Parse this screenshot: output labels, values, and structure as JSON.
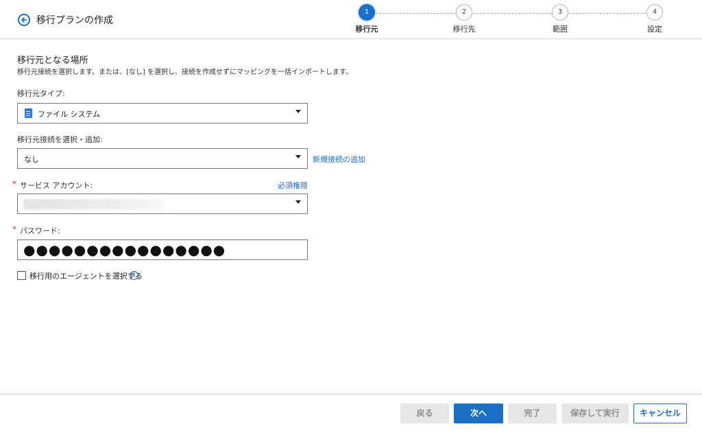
{
  "header": {
    "title": "移行プランの作成",
    "steps": [
      {
        "number": "1",
        "label": "移行元",
        "active": true
      },
      {
        "number": "2",
        "label": "移行先",
        "active": false
      },
      {
        "number": "3",
        "label": "範囲",
        "active": false
      },
      {
        "number": "4",
        "label": "設定",
        "active": false
      }
    ]
  },
  "section": {
    "title": "移行元となる場所",
    "description": "移行元接続を選択します。または、[なし] を選択し、接続を作成せずにマッピングを一括インポートします。"
  },
  "source_type": {
    "label": "移行元タイプ:",
    "value": "ファイル システム"
  },
  "connection": {
    "label": "移行元接続を選択・追加:",
    "value": "なし",
    "add_link": "新規接続の追加"
  },
  "service_account": {
    "required_mark": "*",
    "label": "サービス アカウント:",
    "permissions_link": "必須権限"
  },
  "password": {
    "required_mark": "*",
    "label": "パスワード:",
    "masked_value": "●●●●●●●●●●●●●●●●"
  },
  "agent": {
    "label": "移行用のエージェントを選択する",
    "checked": false,
    "info_glyph": "i"
  },
  "footer": {
    "back_label": "戻る",
    "next_label": "次へ",
    "finish_label": "完了",
    "save_run_label": "保存して実行",
    "cancel_label": "キャンセル"
  },
  "colors": {
    "accent": "#1b6fc5",
    "required": "#d9302c",
    "disabled_bg": "#e6e6e6"
  }
}
